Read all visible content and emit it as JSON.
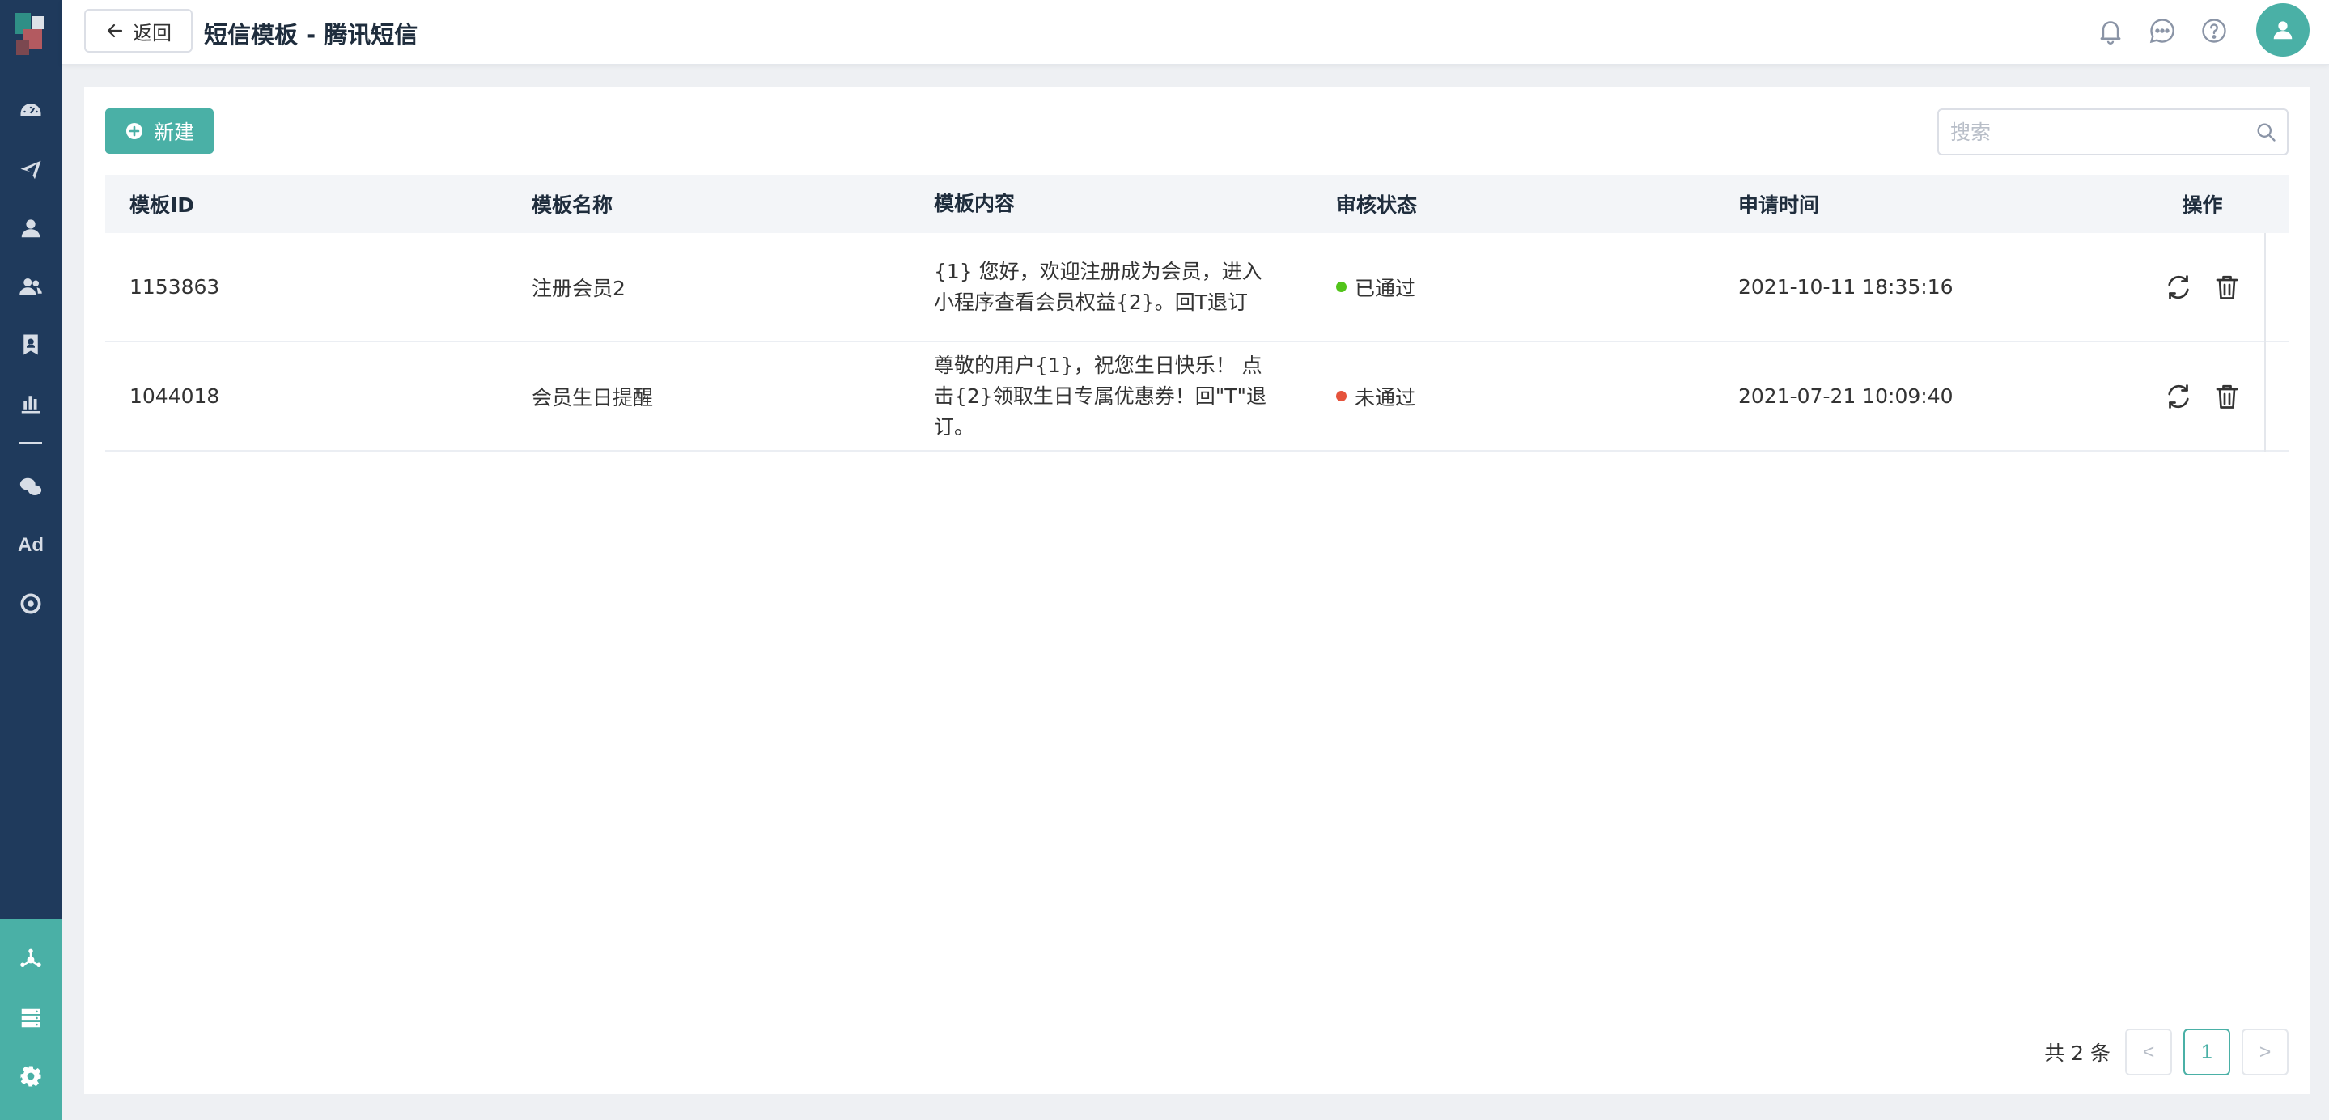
{
  "header": {
    "back_label": "返回",
    "title": "短信模板 - 腾讯短信",
    "icons": [
      "bell-icon",
      "message-icon",
      "help-icon",
      "user-icon"
    ]
  },
  "sidebar": {
    "items": [
      "dashboard-icon",
      "send-icon",
      "user-icon",
      "group-icon",
      "badge-icon",
      "chart-icon",
      "wechat-icon",
      "ad-icon",
      "target-icon"
    ],
    "ad_label": "Ad",
    "bottom_items": [
      "hub-icon",
      "server-icon",
      "gear-icon"
    ]
  },
  "toolbar": {
    "new_label": "新建",
    "search_placeholder": "搜索"
  },
  "table": {
    "columns": [
      "模板ID",
      "模板名称",
      "模板内容",
      "审核状态",
      "申请时间",
      "操作"
    ],
    "rows": [
      {
        "id": "1153863",
        "name": "注册会员2",
        "content": "{1} 您好，欢迎注册成为会员，进入小程序查看会员权益{2}。回T退订",
        "status": "已通过",
        "status_color": "#52c41a",
        "time": "2021-10-11 18:35:16"
      },
      {
        "id": "1044018",
        "name": "会员生日提醒",
        "content": "尊敬的用户{1}，祝您生日快乐！ 点击{2}领取生日专属优惠券！回\"T\"退订。",
        "status": "未通过",
        "status_color": "#e5533c",
        "time": "2021-07-21 10:09:40"
      }
    ]
  },
  "pagination": {
    "total_text": "共 2 条",
    "current_page": "1",
    "prev": "<",
    "next": ">"
  },
  "colors": {
    "accent": "#4ab0a6",
    "sidebar": "#1f3a5c"
  }
}
